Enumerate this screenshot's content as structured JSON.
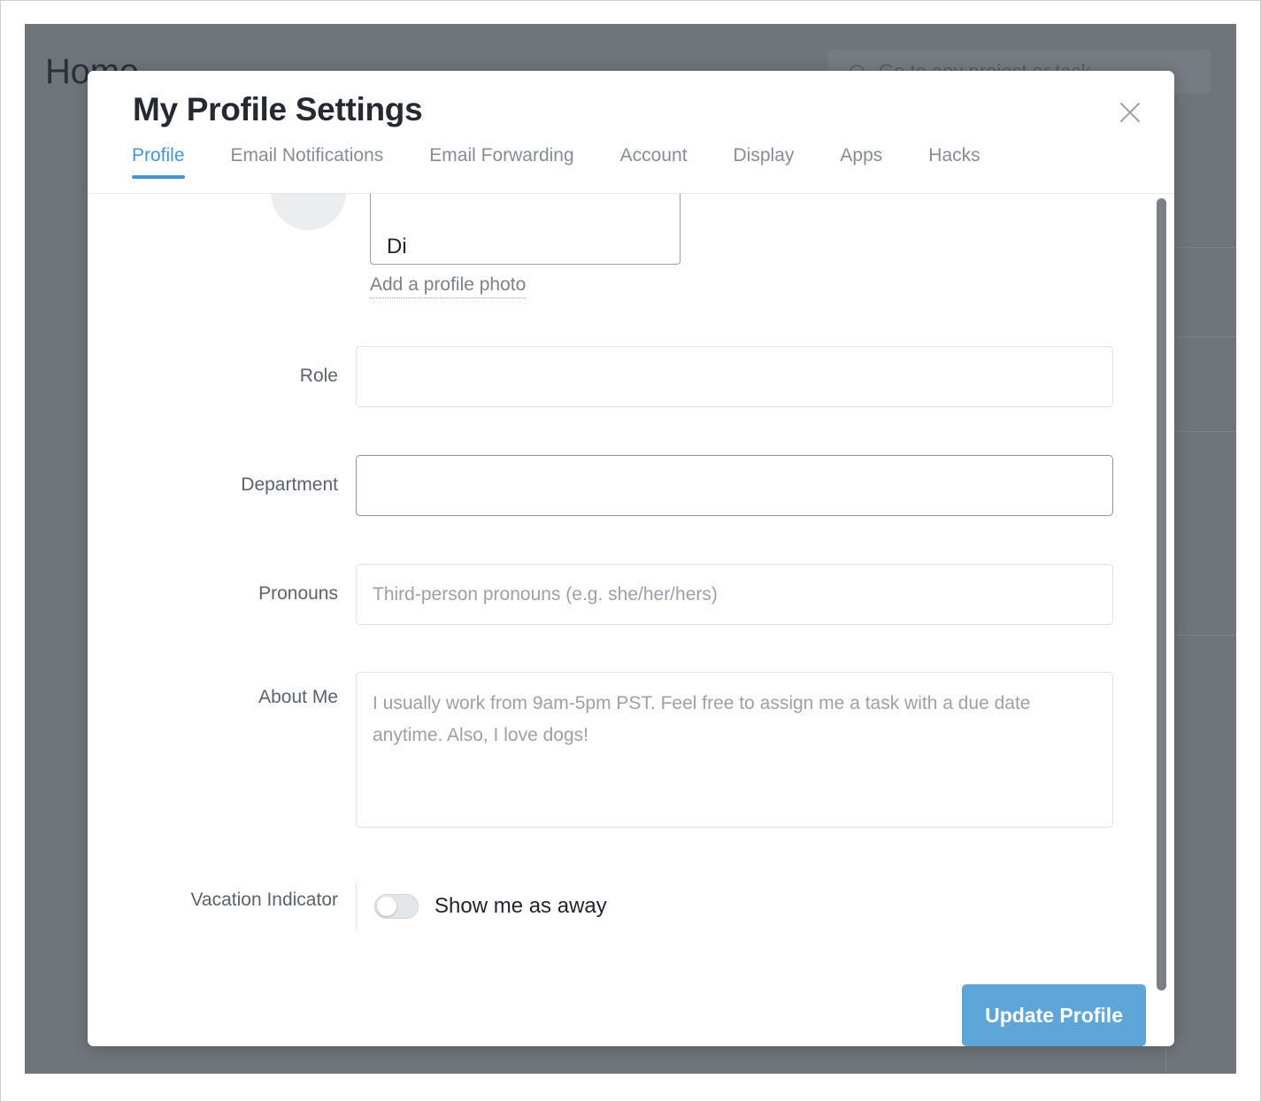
{
  "background": {
    "page_title": "Home",
    "search_placeholder": "Go to any project or task"
  },
  "modal": {
    "title": "My Profile Settings",
    "close_label": "×",
    "tabs": [
      {
        "label": "Profile",
        "active": true
      },
      {
        "label": "Email Notifications",
        "active": false
      },
      {
        "label": "Email Forwarding",
        "active": false
      },
      {
        "label": "Account",
        "active": false
      },
      {
        "label": "Display",
        "active": false
      },
      {
        "label": "Apps",
        "active": false
      },
      {
        "label": "Hacks",
        "active": false
      }
    ],
    "identity": {
      "name_value": "Di",
      "add_photo_label": "Add a profile photo"
    },
    "fields": {
      "role": {
        "label": "Role",
        "value": "",
        "placeholder": ""
      },
      "department": {
        "label": "Department",
        "value": "",
        "placeholder": ""
      },
      "pronouns": {
        "label": "Pronouns",
        "value": "",
        "placeholder": "Third-person pronouns (e.g. she/her/hers)"
      },
      "about_me": {
        "label": "About Me",
        "value": "",
        "placeholder": "I usually work from 9am-5pm PST. Feel free to assign me a task with a due date anytime. Also, I love dogs!"
      },
      "vacation": {
        "label": "Vacation Indicator",
        "toggle_label": "Show me as away",
        "toggle_on": false
      }
    },
    "footer": {
      "submit_label": "Update Profile"
    }
  },
  "colors": {
    "accent": "#4a93d1",
    "button": "#5ea6d7",
    "overlay": "#6f757b",
    "label": "#5c636b",
    "placeholder": "#9ba1a8"
  }
}
